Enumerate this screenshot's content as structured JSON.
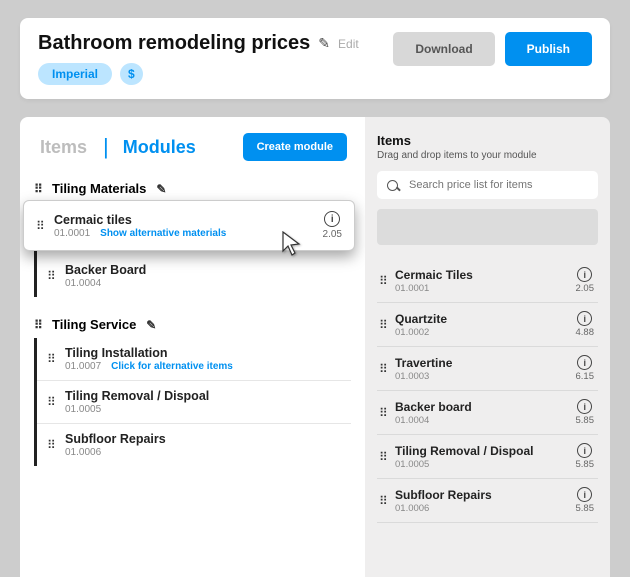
{
  "header": {
    "title": "Bathroom remodeling prices",
    "edit_label": "Edit",
    "chips": {
      "imperial": "Imperial",
      "currency": "$"
    },
    "download": "Download",
    "publish": "Publish"
  },
  "tabs": {
    "items": "Items",
    "modules": "Modules",
    "create": "Create module"
  },
  "groups": [
    {
      "name": "Tiling Materials",
      "items": [
        {
          "name": "Cermaic tiles",
          "code": "01.0001",
          "alt": "Show alternative materials",
          "price": "2.05"
        },
        {
          "name": "Backer Board",
          "code": "01.0004"
        }
      ]
    },
    {
      "name": "Tiling Service",
      "items": [
        {
          "name": "Tiling Installation",
          "code": "01.0007",
          "alt": "Click for alternative items"
        },
        {
          "name": "Tiling Removal / Dispoal",
          "code": "01.0005"
        },
        {
          "name": "Subfloor Repairs",
          "code": "01.0006"
        }
      ]
    }
  ],
  "panel": {
    "title": "Items",
    "hint": "Drag and drop items to your module",
    "search_placeholder": "Search price list for items",
    "items": [
      {
        "name": "Cermaic Tiles",
        "code": "01.0001",
        "price": "2.05"
      },
      {
        "name": "Quartzite",
        "code": "01.0002",
        "price": "4.88"
      },
      {
        "name": "Travertine",
        "code": "01.0003",
        "price": "6.15"
      },
      {
        "name": "Backer board",
        "code": "01.0004",
        "price": "5.85"
      },
      {
        "name": "Tiling Removal / Dispoal",
        "code": "01.0005",
        "price": "5.85"
      },
      {
        "name": "Subfloor Repairs",
        "code": "01.0006",
        "price": "5.85"
      }
    ]
  }
}
